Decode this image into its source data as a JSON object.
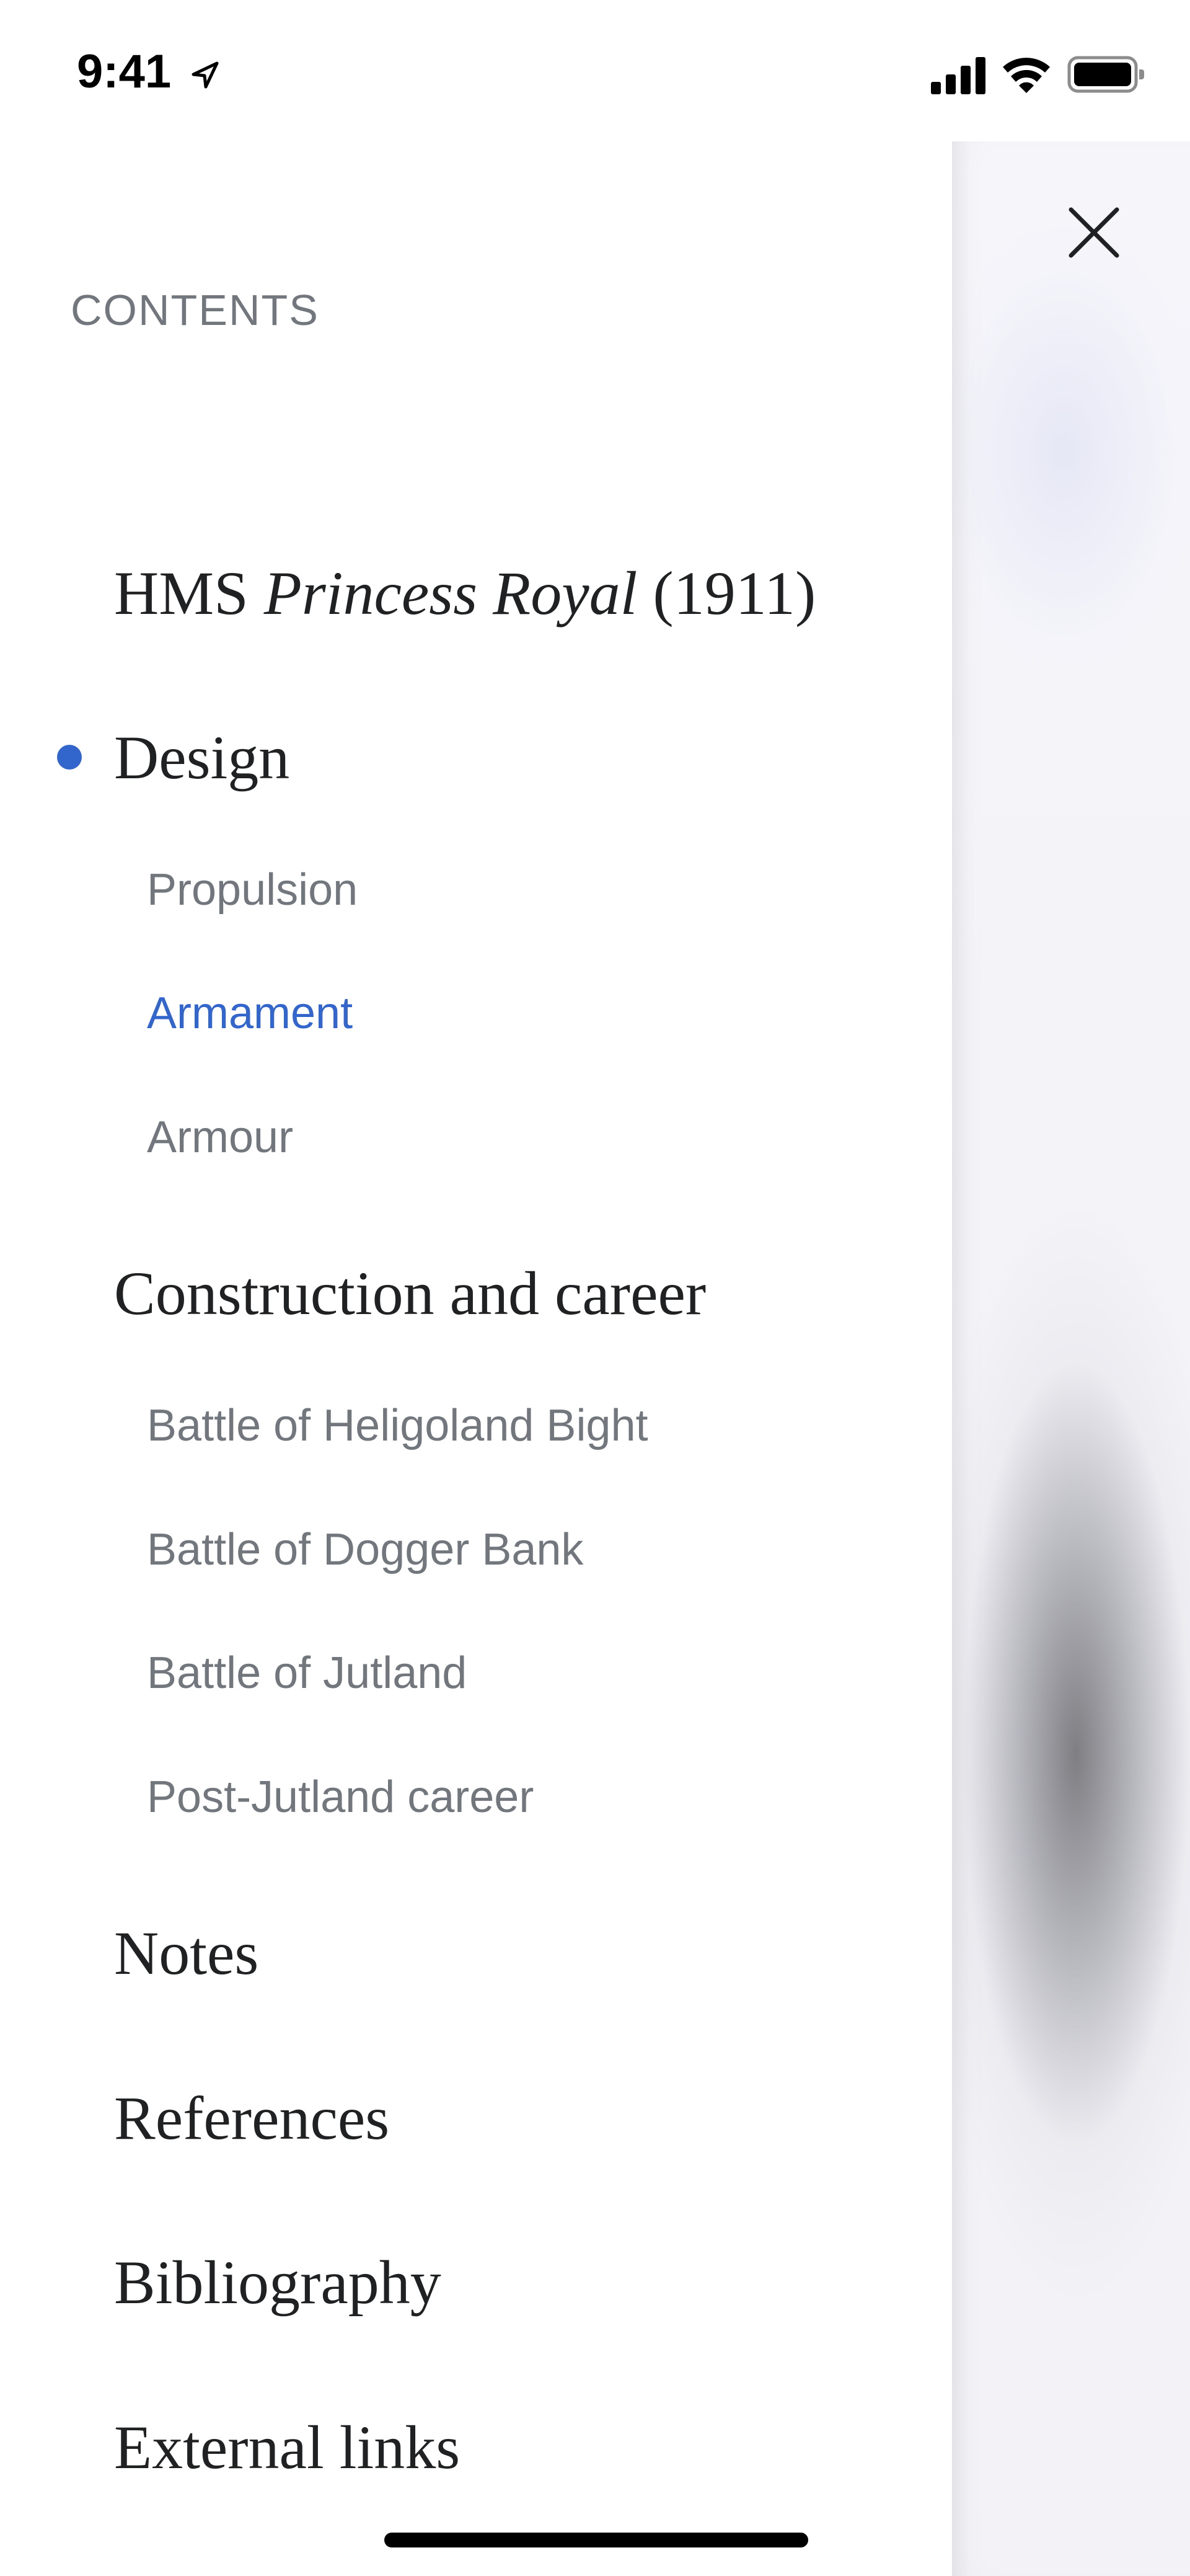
{
  "status_bar": {
    "time": "9:41",
    "icons": [
      "location-arrow-icon",
      "cellular-signal-icon",
      "wifi-icon",
      "battery-icon"
    ]
  },
  "contents": {
    "heading": "CONTENTS",
    "title": {
      "prefix": "HMS ",
      "italic": "Princess Royal",
      "suffix": " (1911)"
    },
    "sections": [
      {
        "label": "Design",
        "current": true,
        "subsections": [
          {
            "label": "Propulsion",
            "active": false
          },
          {
            "label": "Armament",
            "active": true
          },
          {
            "label": "Armour",
            "active": false
          }
        ]
      },
      {
        "label": "Construction and career",
        "current": false,
        "subsections": [
          {
            "label": "Battle of Heligoland Bight",
            "active": false
          },
          {
            "label": "Battle of Dogger Bank",
            "active": false
          },
          {
            "label": "Battle of Jutland",
            "active": false
          },
          {
            "label": "Post-Jutland career",
            "active": false
          }
        ]
      },
      {
        "label": "Notes",
        "current": false,
        "subsections": []
      },
      {
        "label": "References",
        "current": false,
        "subsections": []
      },
      {
        "label": "Bibliography",
        "current": false,
        "subsections": []
      },
      {
        "label": "External links",
        "current": false,
        "subsections": []
      }
    ]
  },
  "colors": {
    "accent": "#3366cc",
    "heading_text": "#202122",
    "subsection_text": "#72777d"
  },
  "close_icon": "close-icon"
}
